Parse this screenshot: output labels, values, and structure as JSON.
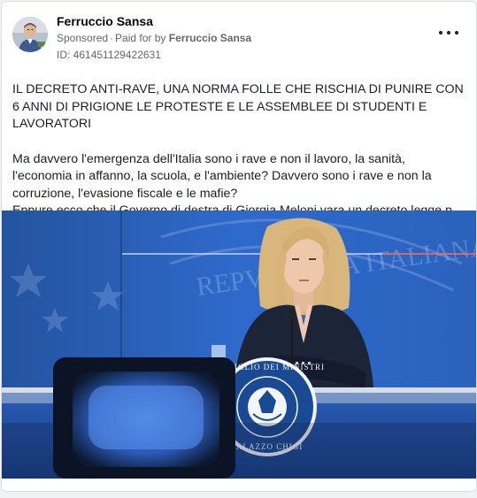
{
  "post": {
    "author": "Ferruccio Sansa",
    "sponsored_label": "Sponsored",
    "paid_for_prefix": "Paid for by",
    "paid_for_by": "Ferruccio Sansa",
    "ad_id": "ID: 461451129422631",
    "more_icon": "three-dots-icon",
    "headline": "IL DECRETO ANTI-RAVE, UNA NORMA FOLLE CHE RISCHIA DI PUNIRE CON 6 ANNI DI PRIGIONE LE PROTESTE E LE ASSEMBLEE DI STUDENTI E LAVORATORI",
    "paragraph": "Ma davvero l'emergenza dell'Italia sono i rave e non il lavoro, la sanità, l'economia in affanno, la scuola, e l'ambiente? Davvero sono i rave e non la corruzione, l'evasione fiscale e le mafie?",
    "truncated_line": "Eppure ecco che il Governo di destra di Giorgia Meloni vara un decreto legge privato di ogni fondamento"
  },
  "image": {
    "seal_text_top": "CONSIGLIO DEI MINISTRI",
    "seal_text_bottom": "PALAZZO CHIGI",
    "backdrop_text": "REPVBBLICA ITALIANA"
  },
  "colors": {
    "backdrop_blue": "#2c66c4",
    "podium_blue": "#1f4f9e",
    "seal_blue": "#1a3f86",
    "card_bg": "#ffffff",
    "page_bg": "#f0f2f5"
  }
}
